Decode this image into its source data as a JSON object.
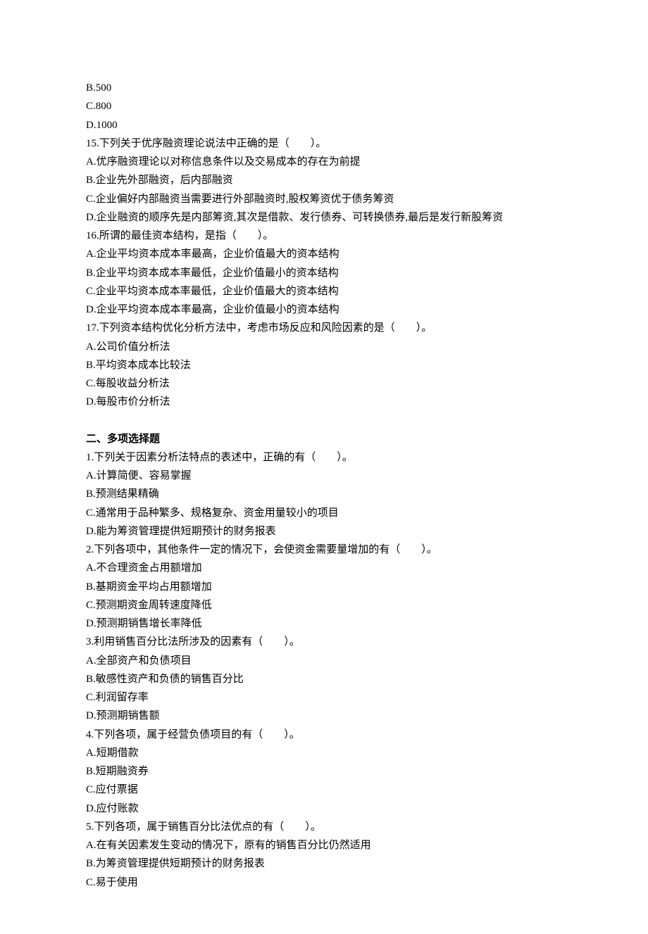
{
  "section1": {
    "q14": {
      "options": [
        "B.500",
        "C.800",
        "D.1000"
      ]
    },
    "q15": {
      "stem": "15.下列关于优序融资理论说法中正确的是（　　）。",
      "options": [
        "A.优序融资理论以对称信息条件以及交易成本的存在为前提",
        "B.企业先外部融资，后内部融资",
        "C.企业偏好内部融资当需要进行外部融资时,股权筹资优于债务筹资",
        "D.企业融资的顺序先是内部筹资,其次是借款、发行债券、可转换债券,最后是发行新股筹资"
      ]
    },
    "q16": {
      "stem": "16.所谓的最佳资本结构，是指（　　）。",
      "options": [
        "A.企业平均资本成本率最高，企业价值最大的资本结构",
        "B.企业平均资本成本率最低，企业价值最小的资本结构",
        "C.企业平均资本成本率最低，企业价值最大的资本结构",
        "D.企业平均资本成本率最高，企业价值最小的资本结构"
      ]
    },
    "q17": {
      "stem": "17.下列资本结构优化分析方法中，考虑市场反应和风险因素的是（　　）。",
      "options": [
        "A.公司价值分析法",
        "B.平均资本成本比较法",
        "C.每股收益分析法",
        "D.每股市价分析法"
      ]
    }
  },
  "section2": {
    "heading": "二、多项选择题",
    "q1": {
      "stem": "1.下列关于因素分析法特点的表述中，正确的有（　　）。",
      "options": [
        "A.计算简便、容易掌握",
        "B.预测结果精确",
        "C.通常用于品种繁多、规格复杂、资金用量较小的项目",
        "D.能为筹资管理提供短期预计的财务报表"
      ]
    },
    "q2": {
      "stem": "2.下列各项中，其他条件一定的情况下，会使资金需要量增加的有（　　）。",
      "options": [
        "A.不合理资金占用额增加",
        "B.基期资金平均占用额增加",
        "C.预测期资金周转速度降低",
        "D.预测期销售增长率降低"
      ]
    },
    "q3": {
      "stem": "3.利用销售百分比法所涉及的因素有（　　）。",
      "options": [
        "A.全部资产和负债项目",
        "B.敏感性资产和负债的销售百分比",
        "C.利润留存率",
        "D.预测期销售额"
      ]
    },
    "q4": {
      "stem": "4.下列各项，属于经营负债项目的有（　　）。",
      "options": [
        "A.短期借款",
        "B.短期融资券",
        "C.应付票据",
        "D.应付账款"
      ]
    },
    "q5": {
      "stem": "5.下列各项，属于销售百分比法优点的有（　　）。",
      "options": [
        "A.在有关因素发生变动的情况下，原有的销售百分比仍然适用",
        "B.为筹资管理提供短期预计的财务报表",
        "C.易于使用"
      ]
    }
  }
}
